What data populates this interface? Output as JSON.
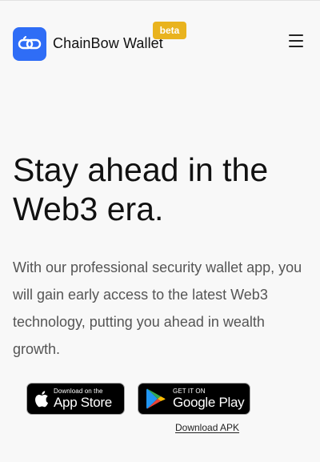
{
  "header": {
    "brand_name": "ChainBow Wallet",
    "badge": "beta",
    "accent_color": "#2f6df6",
    "badge_color": "#e9b31e",
    "menu_icon": "hamburger-menu-icon",
    "logo_icon": "chain-link-icon"
  },
  "hero": {
    "title": "Stay ahead in the Web3 era.",
    "description": "With our professional security wallet app, you will gain early access to the latest Web3 technology, putting you ahead in wealth growth."
  },
  "downloads": {
    "app_store": {
      "small": "Download on the",
      "big": "App Store",
      "icon": "apple-icon"
    },
    "google_play": {
      "small": "GET IT ON",
      "big": "Google Play",
      "icon": "google-play-icon"
    },
    "apk_link": "Download APK"
  }
}
